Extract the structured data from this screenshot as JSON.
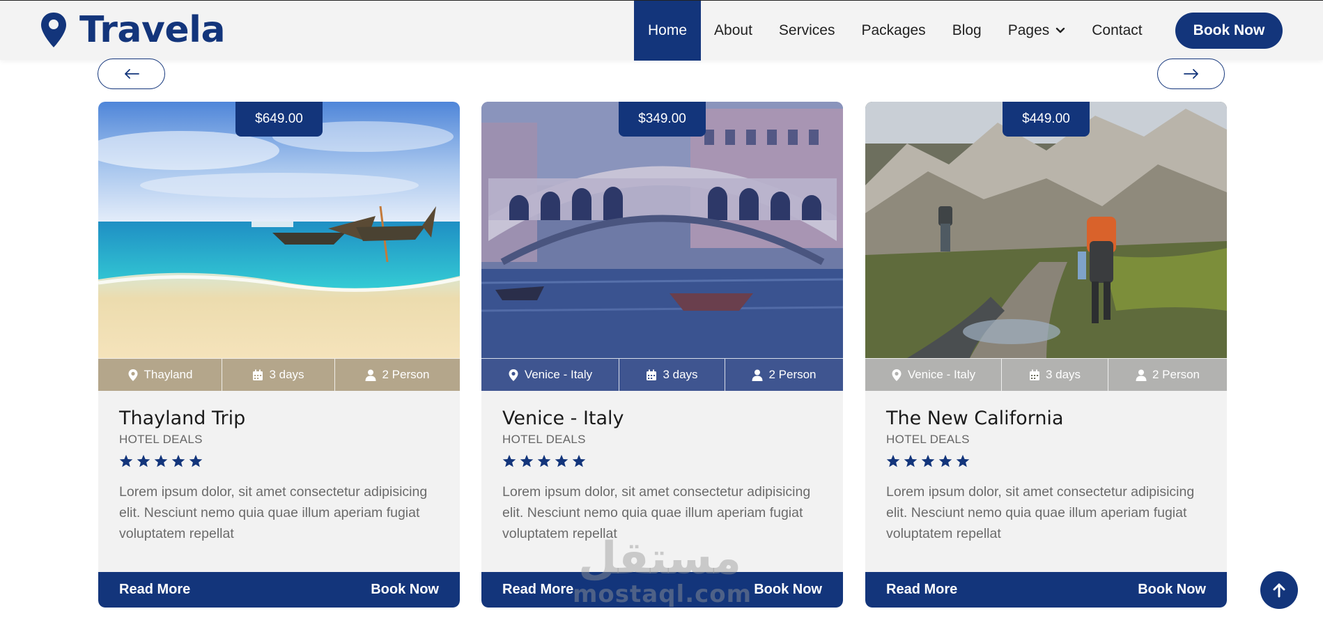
{
  "brand": {
    "name": "Travela"
  },
  "nav": {
    "items": [
      {
        "label": "Home",
        "active": true
      },
      {
        "label": "About"
      },
      {
        "label": "Services"
      },
      {
        "label": "Packages"
      },
      {
        "label": "Blog"
      },
      {
        "label": "Pages",
        "dropdown": true
      },
      {
        "label": "Contact"
      }
    ],
    "cta_label": "Book Now"
  },
  "carousel": {
    "prev_icon": "arrow-left-icon",
    "next_icon": "arrow-right-icon"
  },
  "packages": [
    {
      "price": "$649.00",
      "image": "beach-longtail-boats",
      "location": "Thayland",
      "duration": "3 days",
      "persons": "2 Person",
      "title": "Thayland Trip",
      "category": "HOTEL DEALS",
      "rating": 5,
      "description": "Lorem ipsum dolor, sit amet consectetur adipisicing elit. Nesciunt nemo quia quae illum aperiam fugiat voluptatem repellat",
      "read_more": "Read More",
      "book_now": "Book Now"
    },
    {
      "price": "$349.00",
      "image": "venice-rialto-bridge",
      "location": "Venice - Italy",
      "duration": "3 days",
      "persons": "2 Person",
      "title": "Venice - Italy",
      "category": "HOTEL DEALS",
      "rating": 5,
      "description": "Lorem ipsum dolor, sit amet consectetur adipisicing elit. Nesciunt nemo quia quae illum aperiam fugiat voluptatem repellat",
      "read_more": "Read More",
      "book_now": "Book Now"
    },
    {
      "price": "$449.00",
      "image": "mountain-hikers",
      "location": "Venice - Italy",
      "duration": "3 days",
      "persons": "2 Person",
      "title": "The New California",
      "category": "HOTEL DEALS",
      "rating": 5,
      "description": "Lorem ipsum dolor, sit amet consectetur adipisicing elit. Nesciunt nemo quia quae illum aperiam fugiat voluptatem repellat",
      "read_more": "Read More",
      "book_now": "Book Now"
    }
  ],
  "watermark": {
    "arabic": "مستقل",
    "latin": "mostaql.com"
  },
  "colors": {
    "primary": "#13357b",
    "card_bg": "#f2f2f2",
    "nav_bg": "#f3f3f3"
  }
}
